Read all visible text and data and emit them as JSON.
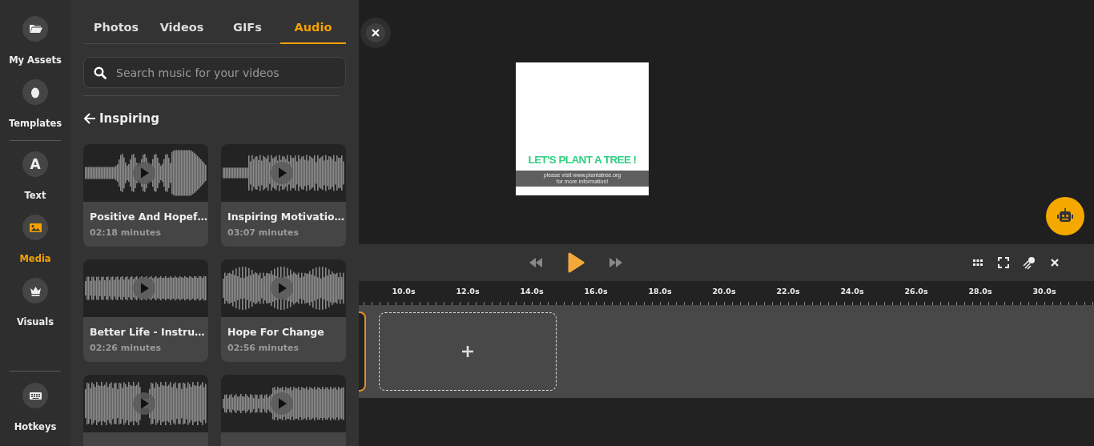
{
  "rail": {
    "groups": [
      {
        "items": [
          {
            "kind": "folder",
            "label": "My Assets",
            "selected": false
          },
          {
            "kind": "egg",
            "label": "Templates",
            "selected": false
          }
        ]
      },
      {
        "items": [
          {
            "kind": "letter",
            "glyph": "A",
            "label": "Text",
            "selected": false
          },
          {
            "kind": "image",
            "label": "Media",
            "selected": true
          },
          {
            "kind": "crown",
            "label": "Visuals",
            "selected": false
          }
        ]
      }
    ],
    "bottom_items": [
      {
        "kind": "keyboard",
        "label": "Hotkeys",
        "selected": false
      }
    ]
  },
  "panel": {
    "tabs": [
      {
        "label": "Photos",
        "selected": false
      },
      {
        "label": "Videos",
        "selected": false
      },
      {
        "label": "GIFs",
        "selected": false
      },
      {
        "label": "Audio",
        "selected": true
      }
    ],
    "search": {
      "placeholder": "Search music for your videos"
    },
    "category": "Inspiring",
    "cards": [
      {
        "kind": "full",
        "title": "Positive And Hopef…",
        "duration": "02:18 minutes"
      },
      {
        "kind": "full",
        "title": "Inspiring Motivatio…",
        "duration": "03:07 minutes"
      },
      {
        "kind": "full",
        "title": "Better Life - Instru…",
        "duration": "02:26 minutes"
      },
      {
        "kind": "full",
        "title": "Hope For Change",
        "duration": "02:56 minutes"
      },
      {
        "kind": "cut"
      },
      {
        "kind": "cut"
      }
    ]
  },
  "preview": {
    "headline": "LET'S PLANT A TREE !",
    "banner_lines": [
      "please visit www.plantatree.org",
      "for more information!"
    ]
  },
  "timeline": {
    "ruler": [
      "10.0s",
      "12.0s",
      "14.0s",
      "16.0s",
      "18.0s",
      "20.0s",
      "22.0s",
      "24.0s",
      "26.0s",
      "28.0s",
      "30.0s"
    ]
  }
}
